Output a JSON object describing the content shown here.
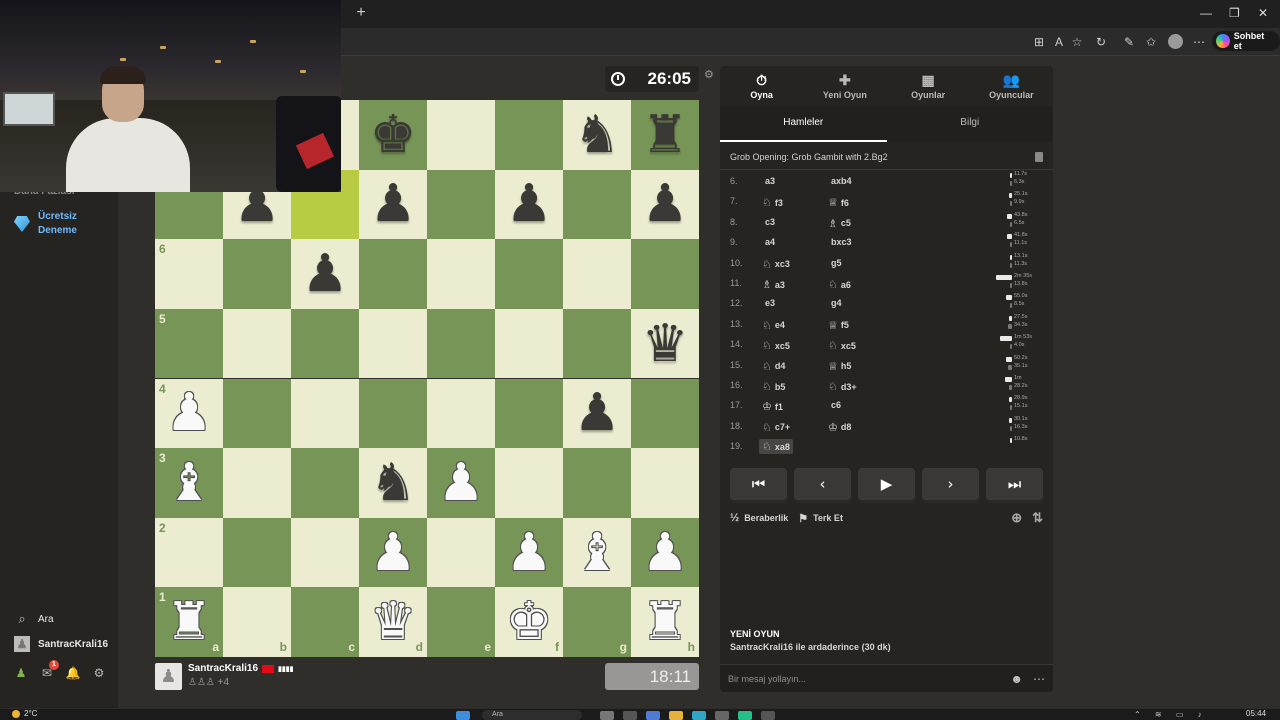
{
  "browser": {
    "newtab_symbol": "+",
    "window_controls": [
      "—",
      "❐",
      "✕"
    ],
    "copilot_label": "Sohbet et"
  },
  "sidebar": {
    "cut_label": "Daha Fazlası",
    "free_trial": "Ücretsiz Deneme",
    "search_label": "Ara",
    "username": "SantracKrali16",
    "mail_badge": "1"
  },
  "clock_top": "26:05",
  "clock_bottom": "18:11",
  "player_bottom": {
    "name": "SantracKrali16",
    "rating_bars": "▮▮▮▮",
    "captured": "♙♙♙ +4"
  },
  "board": {
    "files": [
      "a",
      "b",
      "c",
      "d",
      "e",
      "f",
      "g",
      "h"
    ],
    "ranks": [
      "8",
      "7",
      "6",
      "5",
      "4",
      "3",
      "2",
      "1"
    ],
    "highlight": [
      "c7"
    ],
    "pieces": {
      "d8": "bK",
      "g8": "bN",
      "h8": "bR",
      "b7": "bP",
      "d7": "bP",
      "f7": "bP",
      "h7": "bP",
      "c6": "bP",
      "h5": "bQ",
      "a4": "wP",
      "g4": "bP",
      "a3": "wB",
      "d3": "bN",
      "e3": "wP",
      "d2": "wP",
      "f2": "wP",
      "g2": "wB",
      "h2": "wP",
      "a1": "wR",
      "d1": "wQ",
      "f1": "wK",
      "h1": "wR"
    }
  },
  "panel": {
    "tabs": [
      {
        "label": "Oyna",
        "icon": "⏱",
        "active": true
      },
      {
        "label": "Yeni Oyun",
        "icon": "✚",
        "active": false
      },
      {
        "label": "Oyunlar",
        "icon": "▦",
        "active": false
      },
      {
        "label": "Oyuncular",
        "icon": "👥",
        "active": false
      }
    ],
    "subtabs": [
      "Hamleler",
      "Bilgi"
    ],
    "opening": "Grob Opening: Grob Gambit with 2.Bg2",
    "moves": [
      {
        "num": "6.",
        "w": "a3",
        "wp": "",
        "b": "axb4",
        "bp": "",
        "tw": "11.7s",
        "tb": "6.3s",
        "fw": 0.08,
        "fb": 0.05
      },
      {
        "num": "7.",
        "w": "f3",
        "wp": "♘",
        "b": "f6",
        "bp": "♕",
        "tw": "25.1s",
        "tb": "9.9s",
        "fw": 0.18,
        "fb": 0.07
      },
      {
        "num": "8.",
        "w": "c3",
        "wp": "",
        "b": "c5",
        "bp": "♗",
        "tw": "43.8s",
        "tb": "6.5s",
        "fw": 0.3,
        "fb": 0.05
      },
      {
        "num": "9.",
        "w": "a4",
        "wp": "",
        "b": "bxc3",
        "bp": "",
        "tw": "41.8s",
        "tb": "11.1s",
        "fw": 0.29,
        "fb": 0.08
      },
      {
        "num": "10.",
        "w": "xc3",
        "wp": "♘",
        "b": "g5",
        "bp": "",
        "tw": "13.1s",
        "tb": "11.3s",
        "fw": 0.09,
        "fb": 0.08
      },
      {
        "num": "11.",
        "w": "a3",
        "wp": "♗",
        "b": "a6",
        "bp": "♘",
        "tw": "2m 35s",
        "tb": "13.8s",
        "fw": 1.0,
        "fb": 0.1
      },
      {
        "num": "12.",
        "w": "e3",
        "wp": "",
        "b": "g4",
        "bp": "",
        "tw": "55.0s",
        "tb": "8.5s",
        "fw": 0.38,
        "fb": 0.06
      },
      {
        "num": "13.",
        "w": "e4",
        "wp": "♘",
        "b": "f5",
        "bp": "♕",
        "tw": "27.5s",
        "tb": "34.3s",
        "fw": 0.19,
        "fb": 0.24
      },
      {
        "num": "14.",
        "w": "xc5",
        "wp": "♘",
        "b": "xc5",
        "bp": "♘",
        "tw": "1m 53s",
        "tb": "4.0s",
        "fw": 0.78,
        "fb": 0.03
      },
      {
        "num": "15.",
        "w": "d4",
        "wp": "♘",
        "b": "h5",
        "bp": "♕",
        "tw": "50.2s",
        "tb": "35.1s",
        "fw": 0.35,
        "fb": 0.24
      },
      {
        "num": "16.",
        "w": "b5",
        "wp": "♘",
        "b": "d3+",
        "bp": "♘",
        "tw": "1m",
        "tb": "28.2s",
        "fw": 0.41,
        "fb": 0.19
      },
      {
        "num": "17.",
        "w": "f1",
        "wp": "♔",
        "b": "c6",
        "bp": "",
        "tw": "28.9s",
        "tb": "15.1s",
        "fw": 0.2,
        "fb": 0.1
      },
      {
        "num": "18.",
        "w": "c7+",
        "wp": "♘",
        "b": "d8",
        "bp": "♔",
        "tw": "30.1s",
        "tb": "16.3s",
        "fw": 0.21,
        "fb": 0.11
      },
      {
        "num": "19.",
        "w": "xa8",
        "wp": "♘",
        "b": "",
        "bp": "",
        "tw": "10.8s",
        "tb": "",
        "fw": 0.07,
        "fb": 0
      }
    ],
    "controls": [
      "⏮",
      "‹",
      "▶",
      "›",
      "⏭"
    ],
    "draw_icon": "½",
    "draw_label": "Beraberlik",
    "resign_label": "Terk Et",
    "newgame_title": "YENİ OYUN",
    "newgame_desc": "SantracKrali16 ile ardaderince (30 dk)",
    "chat_placeholder": "Bir mesaj yollayın..."
  },
  "taskbar": {
    "temp": "2°C",
    "time": "05:44",
    "search_hint": "Ara"
  },
  "colors": {
    "light_square": "#ebecd0",
    "dark_square": "#779556",
    "highlight": "#b9ca43",
    "panel_bg": "#262421"
  }
}
